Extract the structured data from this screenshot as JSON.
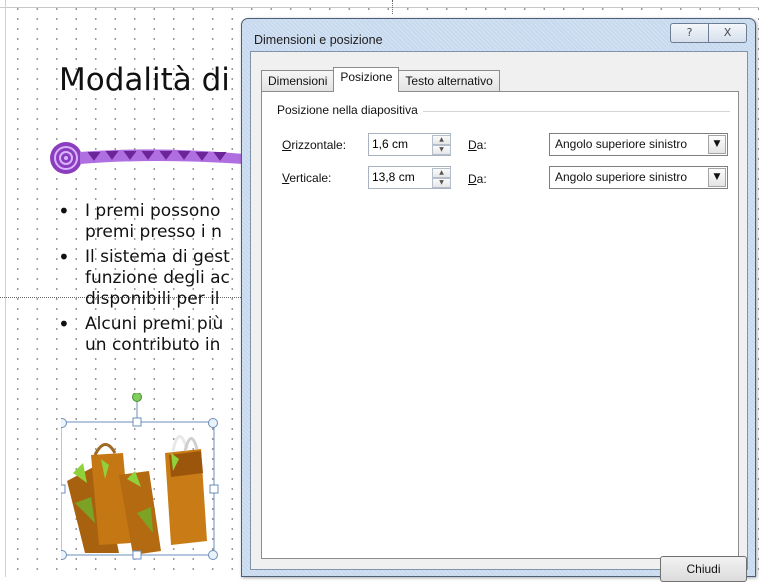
{
  "slide": {
    "title": "Modalità di",
    "bullets": [
      {
        "line1": "I premi possono",
        "line2": "premi presso i n"
      },
      {
        "line1": "Il sistema di gest",
        "line2": "funzione degli ac",
        "line3": "disponibili per il"
      },
      {
        "line1": "Alcuni premi più",
        "line2": "un contributo in"
      }
    ],
    "picture": "shopping-bags-clipart"
  },
  "dialog": {
    "title": "Dimensioni e posizione",
    "help_glyph": "?",
    "close_glyph": "X",
    "tabs": [
      "Dimensioni",
      "Posizione",
      "Testo alternativo"
    ],
    "active_tab": "Posizione",
    "group_label": "Posizione nella diapositiva",
    "horizontal": {
      "label_first": "O",
      "label_rest": "rizzontale:",
      "value": "1,6 cm",
      "from_first": "D",
      "from_rest": "a:",
      "from_value": "Angolo superiore sinistro"
    },
    "vertical": {
      "label_first": "V",
      "label_rest": "erticale:",
      "value": "13,8 cm",
      "from_first": "D",
      "from_rest": "a:",
      "from_value": "Angolo superiore sinistro"
    },
    "close_button": "Chiudi"
  },
  "colors": {
    "dialog_frame": "#c7d9ee",
    "ribbon_purple": "#8b3dbd",
    "handle_green": "#7fcf5a"
  }
}
